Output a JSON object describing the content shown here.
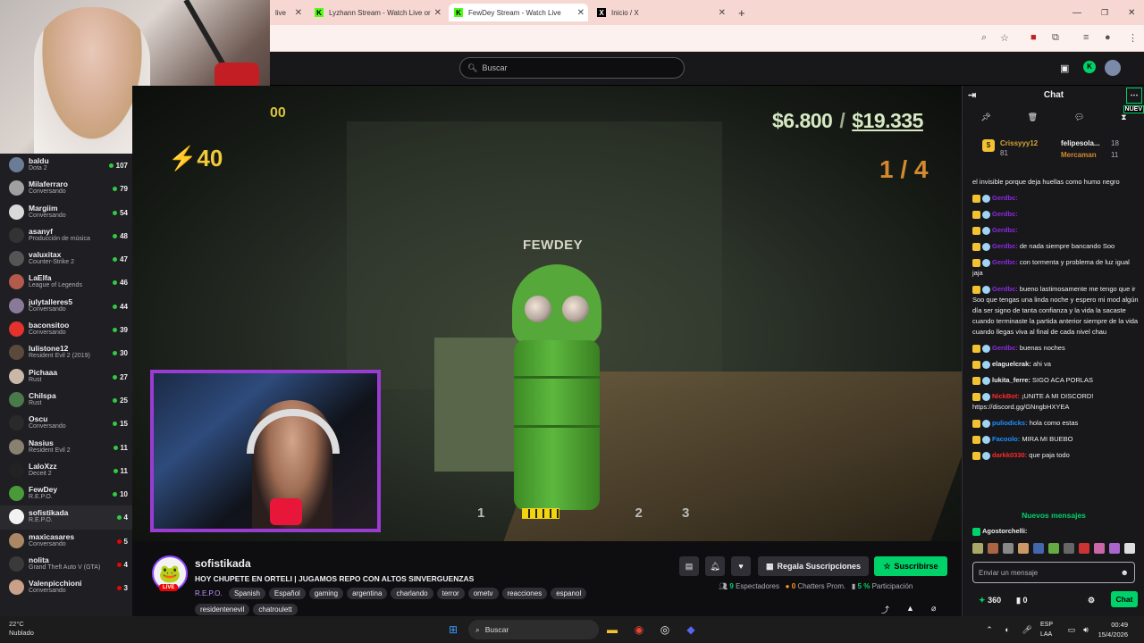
{
  "browser": {
    "tabs": [
      {
        "label": "live",
        "icon": "twitch-icon"
      },
      {
        "label": "Lyzhann Stream - Watch Live or",
        "icon": "kick-icon"
      },
      {
        "label": "FewDey Stream - Watch Live",
        "icon": "kick-icon"
      },
      {
        "label": "Inicio / X",
        "icon": "x-icon"
      }
    ],
    "new_tab": "+"
  },
  "topnav": {
    "search_placeholder": "Buscar"
  },
  "sidebar": {
    "channels": [
      {
        "name": "baldu",
        "game": "Dota 2",
        "viewers": "107",
        "color": "#6b7d96"
      },
      {
        "name": "Milaferraro",
        "game": "Conversando",
        "viewers": "79",
        "color": "#a0a0a0"
      },
      {
        "name": "Margiim",
        "game": "Conversando",
        "viewers": "54",
        "color": "#d9d9d9"
      },
      {
        "name": "asanyf",
        "game": "Producción de música",
        "viewers": "48",
        "color": "#333"
      },
      {
        "name": "valuxitax",
        "game": "Counter-Strike 2",
        "viewers": "47",
        "color": "#555"
      },
      {
        "name": "LaElfa",
        "game": "League of Legends",
        "viewers": "46",
        "color": "#b35a4c"
      },
      {
        "name": "julytalleres5",
        "game": "Conversando",
        "viewers": "44",
        "color": "#8a7a9a"
      },
      {
        "name": "baconsitoo",
        "game": "Conversando",
        "viewers": "39",
        "color": "#e5322d"
      },
      {
        "name": "lulistone12",
        "game": "Resident Evil 2 (2019)",
        "viewers": "30",
        "color": "#5b4a3c"
      },
      {
        "name": "Pichaaa",
        "game": "Rust",
        "viewers": "27",
        "color": "#c9b8a8"
      },
      {
        "name": "Chilspa",
        "game": "Rust",
        "viewers": "25",
        "color": "#4a7a4a"
      },
      {
        "name": "Oscu",
        "game": "Conversando",
        "viewers": "15",
        "color": "#2a2a2a"
      },
      {
        "name": "Nasius",
        "game": "Resident Evil 2",
        "viewers": "11",
        "color": "#8a8070"
      },
      {
        "name": "LaloXzz",
        "game": "Deceit 2",
        "viewers": "11",
        "color": "#222"
      },
      {
        "name": "FewDey",
        "game": "R.E.P.O.",
        "viewers": "10",
        "color": "#4a9a3a"
      },
      {
        "name": "sofistikada",
        "game": "R.E.P.O.",
        "viewers": "4",
        "color": "#f2f2f2"
      },
      {
        "name": "maxicasares",
        "game": "Conversando",
        "viewers": "5",
        "color": "#aa8866"
      },
      {
        "name": "nolita",
        "game": "Grand Theft Auto V (GTA)",
        "viewers": "4",
        "color": "#3a3a3a"
      },
      {
        "name": "Valenpicchioni",
        "game": "Conversando",
        "viewers": "3",
        "color": "#c9a088"
      }
    ]
  },
  "video": {
    "hud_money": "$6.800",
    "hud_money_total": "$19.335",
    "hud_count": "1 / 4",
    "hud_hp": "40",
    "hud_partial": "00",
    "player_label": "FEWDEY",
    "inv_slots": [
      "1",
      "2",
      "3"
    ]
  },
  "stream": {
    "streamer": "sofistikada",
    "live_badge": "LIVE",
    "title": "HOY CHUPETE EN ORTELI | JUGAMOS REPO CON ALTOS SINVERGUENZAS",
    "game": "R.E.P.O.",
    "tags": [
      "Spanish",
      "Español",
      "gaming",
      "argentina",
      "charlando",
      "terror",
      "ometv",
      "reacciones",
      "espanol"
    ],
    "tags2": [
      "residentenevil",
      "chatroulett"
    ],
    "gift_label": "Regala Suscripciones",
    "sub_label": "Suscribirse",
    "viewers": "9",
    "viewers_label": "Espectadores",
    "chatters": "0",
    "chatters_label": "Chatters Prom.",
    "participation": "5 %",
    "participation_label": "Participación"
  },
  "chat": {
    "title": "Chat",
    "nuevo": "NUEV",
    "leader1": {
      "name": "Crissyyy12",
      "pts": "81"
    },
    "leader2": {
      "name": "felipesola...",
      "pts": "18"
    },
    "leader3": {
      "name": "Mercaman",
      "pts": "11"
    },
    "messages": [
      {
        "user": "",
        "text": "el invisible porque deja huellas como humo negro",
        "cls": "u-w"
      },
      {
        "user": "Gerdbc:",
        "text": "",
        "cls": "u-m"
      },
      {
        "user": "Gerdbc:",
        "text": "",
        "cls": "u-m"
      },
      {
        "user": "Gerdbc:",
        "text": "",
        "cls": "u-m"
      },
      {
        "user": "Gerdbc:",
        "text": "de nada siempre bancando Soo",
        "cls": "u-m"
      },
      {
        "user": "Gerdbc:",
        "text": "con tormenta y problema de luz igual jaja",
        "cls": "u-m"
      },
      {
        "user": "Gerdbc:",
        "text": "bueno lastimosamente me tengo que ir Soo que tengas una linda noche y espero mi mod algún día ser signo de tanta confianza y la vida la sacaste cuando terminaste la partida anterior siempre de la vida cuando llegas viva al final de cada nivel chau",
        "cls": "u-m"
      },
      {
        "user": "Gerdbc:",
        "text": "buenas noches",
        "cls": "u-m"
      },
      {
        "user": "elaguelcrak:",
        "text": "ahi va",
        "cls": "u-w"
      },
      {
        "user": "lukita_ferre:",
        "text": "SIGO ACA PORLAS",
        "cls": "u-w"
      },
      {
        "user": "NickBot:",
        "text": "¡UNITE A MI DISCORD! https://discord.gg/GNngbHXYEA",
        "cls": "u-r"
      },
      {
        "user": "puliodicks:",
        "text": "hola como estas",
        "cls": "u-b"
      },
      {
        "user": "Facoolo:",
        "text": "MIRA MI BUEBO",
        "cls": "u-b"
      },
      {
        "user": "darkk0330:",
        "text": "que paja todo",
        "cls": "u-r"
      }
    ],
    "nuevos_label": "Nuevos mensajes",
    "last_user": "Agostorchelli:",
    "input_placeholder": "Enviar un mensaje",
    "points": "360",
    "bits": "0",
    "send_label": "Chat"
  },
  "taskbar": {
    "weather_temp": "22°C",
    "weather_desc": "Nublado",
    "search": "Buscar",
    "lang1": "ESP",
    "lang2": "LAA",
    "time": "00:49",
    "date": "15/4/2026"
  }
}
